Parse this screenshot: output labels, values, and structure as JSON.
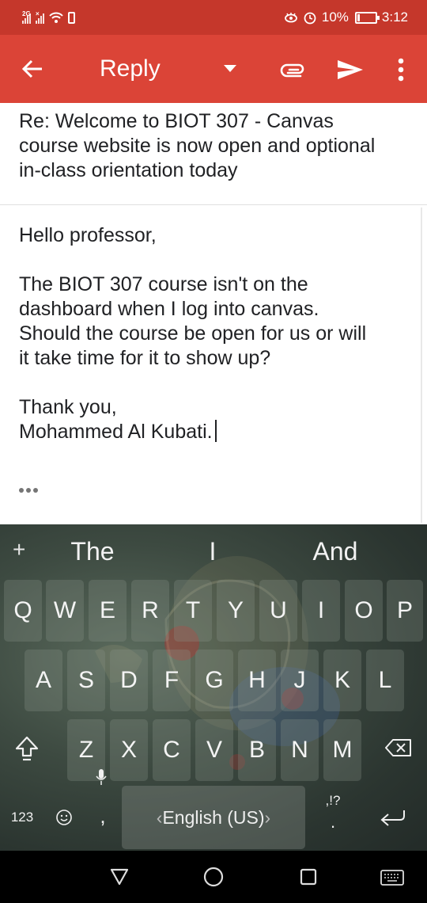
{
  "status_bar": {
    "network": "2G",
    "battery_percent": "10%",
    "time": "3:12",
    "icons": [
      "signal-icon",
      "no-signal-icon",
      "wifi-icon",
      "battery-saver-icon",
      "eye-comfort-icon",
      "alarm-icon",
      "battery-icon"
    ]
  },
  "toolbar": {
    "title": "Reply",
    "icons": [
      "back-arrow-icon",
      "dropdown-caret-icon",
      "attachment-icon",
      "send-icon",
      "more-vert-icon"
    ],
    "color": "#db4437",
    "status_color": "#c5372b"
  },
  "email": {
    "subject_lines": [
      "Re: Welcome to BIOT 307 - Canvas",
      "course website is now open and optional",
      "in-class orientation today"
    ],
    "body_lines": [
      "Hello professor,",
      "",
      "The BIOT 307 course isn't on the",
      "dashboard when I log into canvas.",
      "Should the course be open for us or will",
      "it take time for it to show up?",
      "",
      "Thank you,",
      "Mohammed Al Kubati."
    ]
  },
  "keyboard": {
    "suggestions": [
      "The",
      "I",
      "And"
    ],
    "rows": [
      [
        "Q",
        "W",
        "E",
        "R",
        "T",
        "Y",
        "U",
        "I",
        "O",
        "P"
      ],
      [
        "A",
        "S",
        "D",
        "F",
        "G",
        "H",
        "J",
        "K",
        "L"
      ],
      [
        "Z",
        "X",
        "C",
        "V",
        "B",
        "N",
        "M"
      ]
    ],
    "numbers_label": "123",
    "space_label": "English (US)",
    "space_left_arrow": "‹",
    "space_right_arrow": "›",
    "punct_label": ",!?",
    "comma_label": ",",
    "period_label": "."
  }
}
